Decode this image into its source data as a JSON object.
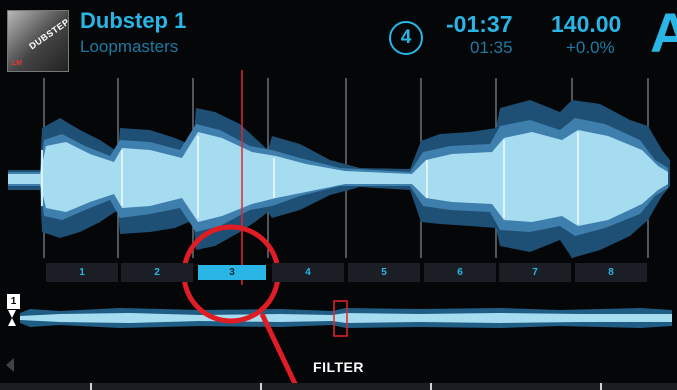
{
  "track": {
    "title": "Dubstep 1",
    "artist": "Loopmasters",
    "cover_text": "DUBSTEP",
    "cover_tag": "LM"
  },
  "status": {
    "beat_counter": "4",
    "time_remaining": "-01:37",
    "time_elapsed": "01:35",
    "bpm": "140.00",
    "pitch": "+0.0%",
    "deck": "A"
  },
  "beat_markers": [
    "1",
    "2",
    "3",
    "4",
    "5",
    "6",
    "7",
    "8"
  ],
  "active_marker": "3",
  "overview": {
    "cue_number": "1"
  },
  "footer": {
    "label": "FILTER"
  },
  "colors": {
    "accent": "#29b6e6",
    "secondary": "#1f7aa3",
    "wave_outer": "#1e4f74",
    "wave_mid": "#3f7fae",
    "wave_inner": "#a6dcef",
    "playhead": "#e4262c",
    "callout": "#e01c24"
  },
  "icons": {
    "beat_counter": "circle-icon",
    "overview_cue": "cue-flag-icon",
    "prev": "left-arrow-icon"
  }
}
